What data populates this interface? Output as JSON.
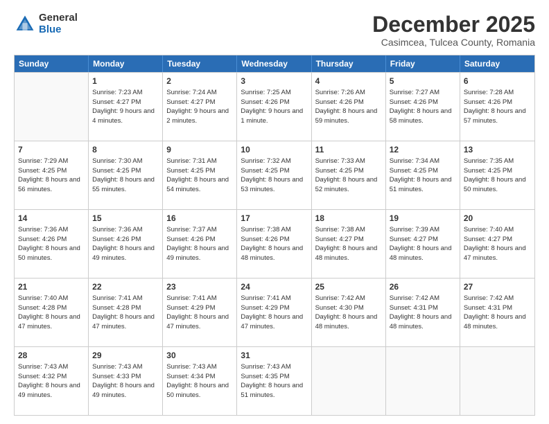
{
  "logo": {
    "general": "General",
    "blue": "Blue"
  },
  "title": "December 2025",
  "location": "Casimcea, Tulcea County, Romania",
  "header_days": [
    "Sunday",
    "Monday",
    "Tuesday",
    "Wednesday",
    "Thursday",
    "Friday",
    "Saturday"
  ],
  "weeks": [
    [
      {
        "day": "",
        "sunrise": "",
        "sunset": "",
        "daylight": ""
      },
      {
        "day": "1",
        "sunrise": "Sunrise: 7:23 AM",
        "sunset": "Sunset: 4:27 PM",
        "daylight": "Daylight: 9 hours and 4 minutes."
      },
      {
        "day": "2",
        "sunrise": "Sunrise: 7:24 AM",
        "sunset": "Sunset: 4:27 PM",
        "daylight": "Daylight: 9 hours and 2 minutes."
      },
      {
        "day": "3",
        "sunrise": "Sunrise: 7:25 AM",
        "sunset": "Sunset: 4:26 PM",
        "daylight": "Daylight: 9 hours and 1 minute."
      },
      {
        "day": "4",
        "sunrise": "Sunrise: 7:26 AM",
        "sunset": "Sunset: 4:26 PM",
        "daylight": "Daylight: 8 hours and 59 minutes."
      },
      {
        "day": "5",
        "sunrise": "Sunrise: 7:27 AM",
        "sunset": "Sunset: 4:26 PM",
        "daylight": "Daylight: 8 hours and 58 minutes."
      },
      {
        "day": "6",
        "sunrise": "Sunrise: 7:28 AM",
        "sunset": "Sunset: 4:26 PM",
        "daylight": "Daylight: 8 hours and 57 minutes."
      }
    ],
    [
      {
        "day": "7",
        "sunrise": "Sunrise: 7:29 AM",
        "sunset": "Sunset: 4:25 PM",
        "daylight": "Daylight: 8 hours and 56 minutes."
      },
      {
        "day": "8",
        "sunrise": "Sunrise: 7:30 AM",
        "sunset": "Sunset: 4:25 PM",
        "daylight": "Daylight: 8 hours and 55 minutes."
      },
      {
        "day": "9",
        "sunrise": "Sunrise: 7:31 AM",
        "sunset": "Sunset: 4:25 PM",
        "daylight": "Daylight: 8 hours and 54 minutes."
      },
      {
        "day": "10",
        "sunrise": "Sunrise: 7:32 AM",
        "sunset": "Sunset: 4:25 PM",
        "daylight": "Daylight: 8 hours and 53 minutes."
      },
      {
        "day": "11",
        "sunrise": "Sunrise: 7:33 AM",
        "sunset": "Sunset: 4:25 PM",
        "daylight": "Daylight: 8 hours and 52 minutes."
      },
      {
        "day": "12",
        "sunrise": "Sunrise: 7:34 AM",
        "sunset": "Sunset: 4:25 PM",
        "daylight": "Daylight: 8 hours and 51 minutes."
      },
      {
        "day": "13",
        "sunrise": "Sunrise: 7:35 AM",
        "sunset": "Sunset: 4:25 PM",
        "daylight": "Daylight: 8 hours and 50 minutes."
      }
    ],
    [
      {
        "day": "14",
        "sunrise": "Sunrise: 7:36 AM",
        "sunset": "Sunset: 4:26 PM",
        "daylight": "Daylight: 8 hours and 50 minutes."
      },
      {
        "day": "15",
        "sunrise": "Sunrise: 7:36 AM",
        "sunset": "Sunset: 4:26 PM",
        "daylight": "Daylight: 8 hours and 49 minutes."
      },
      {
        "day": "16",
        "sunrise": "Sunrise: 7:37 AM",
        "sunset": "Sunset: 4:26 PM",
        "daylight": "Daylight: 8 hours and 49 minutes."
      },
      {
        "day": "17",
        "sunrise": "Sunrise: 7:38 AM",
        "sunset": "Sunset: 4:26 PM",
        "daylight": "Daylight: 8 hours and 48 minutes."
      },
      {
        "day": "18",
        "sunrise": "Sunrise: 7:38 AM",
        "sunset": "Sunset: 4:27 PM",
        "daylight": "Daylight: 8 hours and 48 minutes."
      },
      {
        "day": "19",
        "sunrise": "Sunrise: 7:39 AM",
        "sunset": "Sunset: 4:27 PM",
        "daylight": "Daylight: 8 hours and 48 minutes."
      },
      {
        "day": "20",
        "sunrise": "Sunrise: 7:40 AM",
        "sunset": "Sunset: 4:27 PM",
        "daylight": "Daylight: 8 hours and 47 minutes."
      }
    ],
    [
      {
        "day": "21",
        "sunrise": "Sunrise: 7:40 AM",
        "sunset": "Sunset: 4:28 PM",
        "daylight": "Daylight: 8 hours and 47 minutes."
      },
      {
        "day": "22",
        "sunrise": "Sunrise: 7:41 AM",
        "sunset": "Sunset: 4:28 PM",
        "daylight": "Daylight: 8 hours and 47 minutes."
      },
      {
        "day": "23",
        "sunrise": "Sunrise: 7:41 AM",
        "sunset": "Sunset: 4:29 PM",
        "daylight": "Daylight: 8 hours and 47 minutes."
      },
      {
        "day": "24",
        "sunrise": "Sunrise: 7:41 AM",
        "sunset": "Sunset: 4:29 PM",
        "daylight": "Daylight: 8 hours and 47 minutes."
      },
      {
        "day": "25",
        "sunrise": "Sunrise: 7:42 AM",
        "sunset": "Sunset: 4:30 PM",
        "daylight": "Daylight: 8 hours and 48 minutes."
      },
      {
        "day": "26",
        "sunrise": "Sunrise: 7:42 AM",
        "sunset": "Sunset: 4:31 PM",
        "daylight": "Daylight: 8 hours and 48 minutes."
      },
      {
        "day": "27",
        "sunrise": "Sunrise: 7:42 AM",
        "sunset": "Sunset: 4:31 PM",
        "daylight": "Daylight: 8 hours and 48 minutes."
      }
    ],
    [
      {
        "day": "28",
        "sunrise": "Sunrise: 7:43 AM",
        "sunset": "Sunset: 4:32 PM",
        "daylight": "Daylight: 8 hours and 49 minutes."
      },
      {
        "day": "29",
        "sunrise": "Sunrise: 7:43 AM",
        "sunset": "Sunset: 4:33 PM",
        "daylight": "Daylight: 8 hours and 49 minutes."
      },
      {
        "day": "30",
        "sunrise": "Sunrise: 7:43 AM",
        "sunset": "Sunset: 4:34 PM",
        "daylight": "Daylight: 8 hours and 50 minutes."
      },
      {
        "day": "31",
        "sunrise": "Sunrise: 7:43 AM",
        "sunset": "Sunset: 4:35 PM",
        "daylight": "Daylight: 8 hours and 51 minutes."
      },
      {
        "day": "",
        "sunrise": "",
        "sunset": "",
        "daylight": ""
      },
      {
        "day": "",
        "sunrise": "",
        "sunset": "",
        "daylight": ""
      },
      {
        "day": "",
        "sunrise": "",
        "sunset": "",
        "daylight": ""
      }
    ]
  ]
}
